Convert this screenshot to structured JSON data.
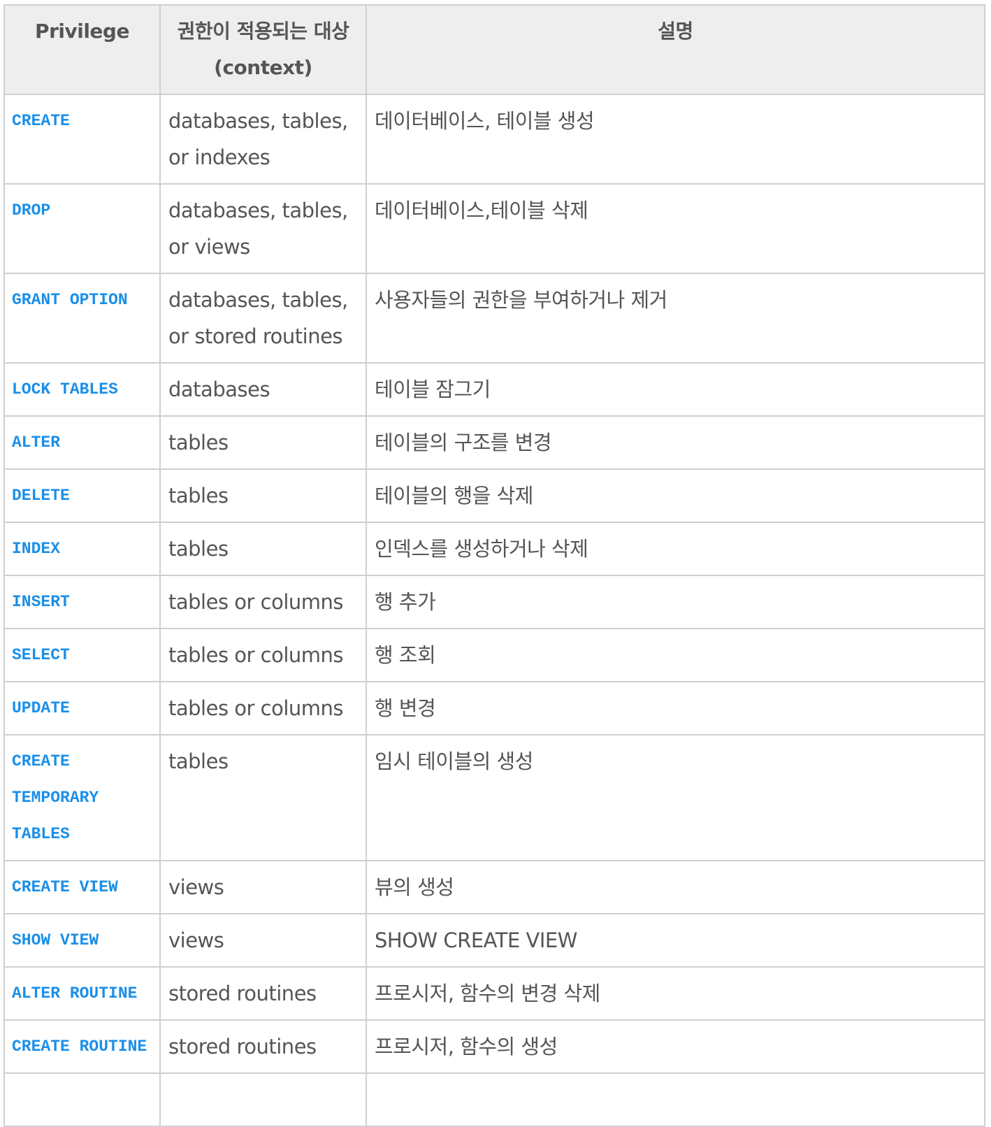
{
  "table": {
    "headers": [
      "Privilege",
      "권한이 적용되는 대상 (context)",
      "설명"
    ],
    "rows": [
      {
        "privilege": "CREATE",
        "context": "databases, tables, or indexes",
        "description": "데이터베이스, 테이블 생성"
      },
      {
        "privilege": "DROP",
        "context": "databases, tables, or views",
        "description": "데이터베이스,테이블 삭제"
      },
      {
        "privilege": "GRANT OPTION",
        "context": "databases, tables, or stored routines",
        "description": "사용자들의 권한을 부여하거나 제거"
      },
      {
        "privilege": "LOCK TABLES",
        "context": "databases",
        "description": "테이블 잠그기"
      },
      {
        "privilege": "ALTER",
        "context": "tables",
        "description": "테이블의 구조를 변경"
      },
      {
        "privilege": "DELETE",
        "context": "tables",
        "description": "테이블의 행을 삭제"
      },
      {
        "privilege": "INDEX",
        "context": "tables",
        "description": "인덱스를 생성하거나 삭제"
      },
      {
        "privilege": "INSERT",
        "context": "tables or columns",
        "description": "행 추가"
      },
      {
        "privilege": "SELECT",
        "context": "tables or columns",
        "description": "행 조회"
      },
      {
        "privilege": "UPDATE",
        "context": "tables or columns",
        "description": "행 변경"
      },
      {
        "privilege": "CREATE TEMPORARY TABLES",
        "context": "tables",
        "description": "임시 테이블의 생성"
      },
      {
        "privilege": "CREATE VIEW",
        "context": "views",
        "description": "뷰의 생성"
      },
      {
        "privilege": "SHOW VIEW",
        "context": "views",
        "description": "SHOW CREATE VIEW"
      },
      {
        "privilege": "ALTER ROUTINE",
        "context": "stored routines",
        "description": "프로시저, 함수의 변경 삭제"
      },
      {
        "privilege": "CREATE ROUTINE",
        "context": "stored routines",
        "description": "프로시저, 함수의 생성"
      }
    ]
  },
  "colors": {
    "privilege_text": "#1a8fe8",
    "header_bg": "#eeeeee",
    "border": "#cfcfcf",
    "text": "#555555"
  }
}
